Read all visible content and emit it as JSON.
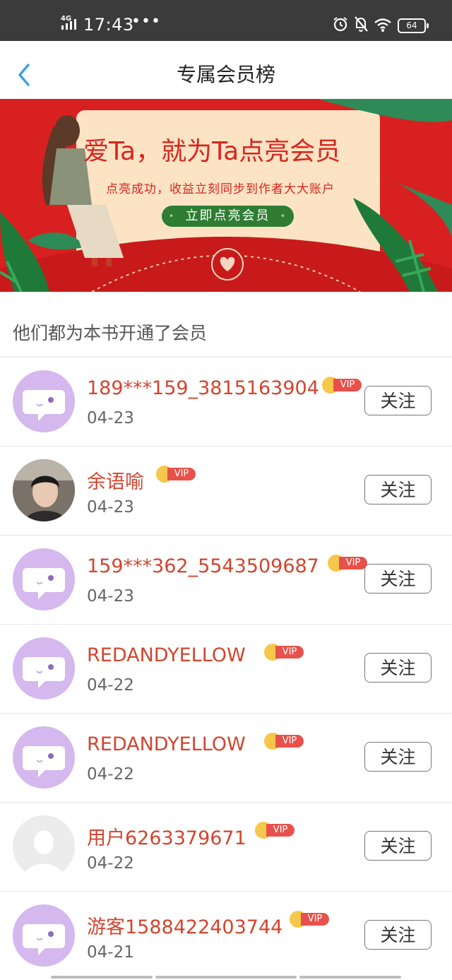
{
  "status_bar": {
    "network": "4G",
    "time": "17:43",
    "dots": "•••",
    "battery": "64",
    "icons": [
      "signal-icon",
      "alarm-icon",
      "bell-muted-icon",
      "wifi-icon",
      "battery-icon"
    ]
  },
  "header": {
    "title": "专属会员榜",
    "back_icon": "chevron-left-icon"
  },
  "banner": {
    "title": "爱Ta，就为Ta点亮会员",
    "subtitle": "点亮成功，收益立刻同步到作者大大账户",
    "button_label": "立即点亮会员",
    "colors": {
      "background": "#d92020",
      "card": "#fbe3c4",
      "button": "#2e7d32"
    }
  },
  "section": {
    "title": "他们都为本书开通了会员"
  },
  "members": [
    {
      "name": "189***159_3815163904",
      "date": "04-23",
      "avatar": "purple",
      "vip": "VIP",
      "follow": "关注"
    },
    {
      "name": "余语喻",
      "date": "04-23",
      "avatar": "photo",
      "vip": "VIP",
      "follow": "关注"
    },
    {
      "name": "159***362_5543509687",
      "date": "04-23",
      "avatar": "purple",
      "vip": "VIP",
      "follow": "关注"
    },
    {
      "name": "REDANDYELLOW",
      "date": "04-22",
      "avatar": "purple",
      "vip": "VIP",
      "follow": "关注"
    },
    {
      "name": "REDANDYELLOW",
      "date": "04-22",
      "avatar": "purple",
      "vip": "VIP",
      "follow": "关注"
    },
    {
      "name": "用户6263379671",
      "date": "04-22",
      "avatar": "blank",
      "vip": "VIP",
      "follow": "关注"
    },
    {
      "name": "游客1588422403744",
      "date": "04-21",
      "avatar": "purple",
      "vip": "VIP",
      "follow": "关注"
    }
  ],
  "colors": {
    "name": "#d2452f",
    "vip_tag": "#e8514b",
    "crown": "#f5c74a",
    "accent_blue": "#3aa0e8"
  }
}
